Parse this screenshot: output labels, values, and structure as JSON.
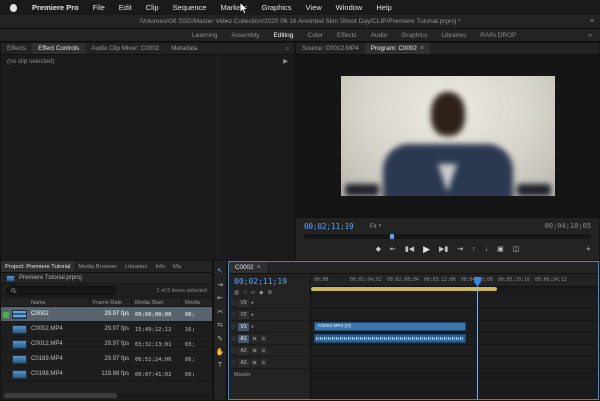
{
  "menubar": {
    "items": [
      "Premiere Pro",
      "File",
      "Edit",
      "Clip",
      "Sequence",
      "Markers",
      "Graphics",
      "View",
      "Window",
      "Help"
    ]
  },
  "titlebar": {
    "path": "/Volumes/G6 SSD/Master Video Collection/2020 06 16 Anointed Skin Shoot Day/CLIP/Premiere Tutorial.prproj *",
    "menu_icon": "≡"
  },
  "workspaces": {
    "items": [
      "Learning",
      "Assembly",
      "Editing",
      "Color",
      "Effects",
      "Audio",
      "Graphics",
      "Libraries",
      "RAIN DROP"
    ],
    "active": "Editing",
    "overflow_icon": "»"
  },
  "effect_controls": {
    "tabs": [
      "Effects",
      "Effect Controls",
      "Audio Clip Mixer: C0002",
      "Metadata"
    ],
    "overflow_icon": "»",
    "empty_message": "(no clip selected)",
    "timeline_toggle_icon": "▶"
  },
  "monitors": {
    "source_tab": "Source: C0012.MP4",
    "program_tab": "Program: C0002",
    "close_icon": "×",
    "timecode": "00;02;11;19",
    "zoom_level": "Fit",
    "dropdown_icon": "▾",
    "duration": "00;04;10;05",
    "transport": [
      {
        "name": "add-marker",
        "glyph": "◆"
      },
      {
        "name": "go-to-in",
        "glyph": "⇤"
      },
      {
        "name": "step-back",
        "glyph": "▮◀"
      },
      {
        "name": "play",
        "glyph": "▶"
      },
      {
        "name": "step-forward",
        "glyph": "▶▮"
      },
      {
        "name": "go-to-out",
        "glyph": "⇥"
      },
      {
        "name": "lift",
        "glyph": "↑"
      },
      {
        "name": "extract",
        "glyph": "↓"
      },
      {
        "name": "export-frame",
        "glyph": "▣"
      },
      {
        "name": "comparison-view",
        "glyph": "◫"
      },
      {
        "name": "add-button",
        "glyph": "+"
      }
    ]
  },
  "project": {
    "tabs": [
      "Project: Premiere Tutorial",
      "Media Browser",
      "Libraries",
      "Info",
      "Ma"
    ],
    "bin_path": "Premiere Tutorial.prproj",
    "selection_status": "1 of 5 items selected",
    "columns": [
      "Name",
      "Frame Rate",
      "Media Start",
      "Media"
    ],
    "rows": [
      {
        "name": "C0002",
        "frame_rate": "29.97 fps",
        "media_start": "00;00;00;00",
        "media_end": "00;"
      },
      {
        "name": "C0002.MP4",
        "frame_rate": "29.97 fps",
        "media_start": "15;49;22;12",
        "media_end": "16;"
      },
      {
        "name": "C0012.MP4",
        "frame_rate": "29.97 fps",
        "media_start": "03;32;13;01",
        "media_end": "03;"
      },
      {
        "name": "C0189.MP4",
        "frame_rate": "29.97 fps",
        "media_start": "06;52;24;00",
        "media_end": "06;"
      },
      {
        "name": "C0198.MP4",
        "frame_rate": "119.88 fps",
        "media_start": "00;07;41;02",
        "media_end": "00;"
      }
    ]
  },
  "tools": [
    {
      "name": "selection-tool",
      "glyph": "↖"
    },
    {
      "name": "track-select-forward-tool",
      "glyph": "⇥"
    },
    {
      "name": "ripple-edit-tool",
      "glyph": "⇤"
    },
    {
      "name": "razor-tool",
      "glyph": "✂"
    },
    {
      "name": "slip-tool",
      "glyph": "⇆"
    },
    {
      "name": "pen-tool",
      "glyph": "✎"
    },
    {
      "name": "hand-tool",
      "glyph": "✋"
    },
    {
      "name": "type-tool",
      "glyph": "T"
    }
  ],
  "timeline": {
    "tab_label": "C0002",
    "close_icon": "×",
    "timecode": "00;02;11;19",
    "toolbar": [
      {
        "name": "nest-indicator",
        "glyph": "▥"
      },
      {
        "name": "snap",
        "glyph": "∩"
      },
      {
        "name": "linked-selection",
        "glyph": "∞"
      },
      {
        "name": "add-marker",
        "glyph": "◆"
      },
      {
        "name": "timeline-settings",
        "glyph": "⚙"
      }
    ],
    "ruler_labels": [
      "00;00",
      "00;01;04;02",
      "00;02;08;04",
      "00;03;12;06",
      "00;04;16;08",
      "00;05;20;10",
      "00;06;24;12"
    ],
    "video_tracks": [
      {
        "label": "V3"
      },
      {
        "label": "V2"
      },
      {
        "label": "V1"
      }
    ],
    "audio_tracks": [
      {
        "label": "A1"
      },
      {
        "label": "A2"
      },
      {
        "label": "A3"
      }
    ],
    "mute_label": "M",
    "solo_label": "S",
    "eye_icon": "●",
    "master_label": "Master",
    "video_clip_label": "C0002.MP4 [V]"
  }
}
